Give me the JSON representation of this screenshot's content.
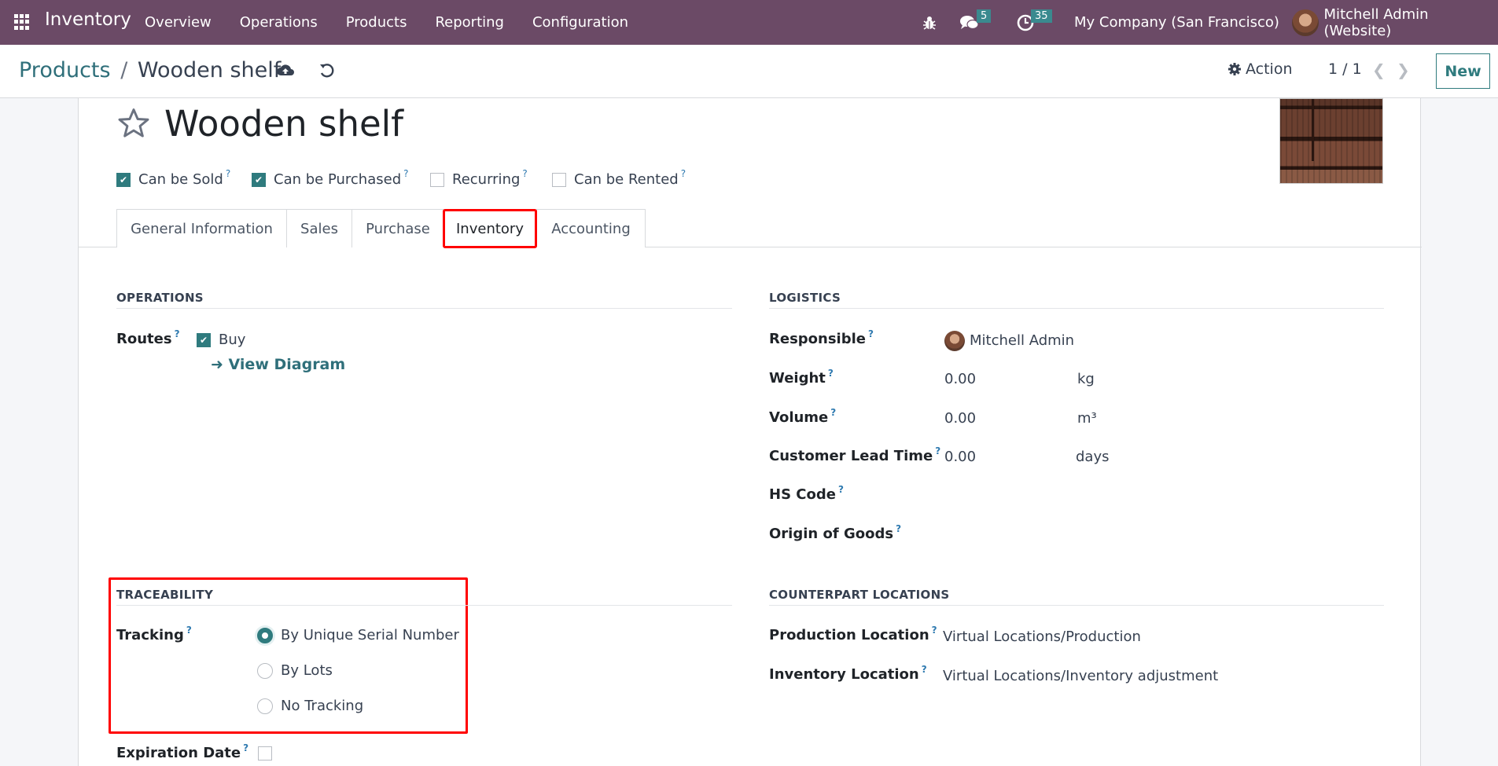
{
  "navbar": {
    "app_name": "Inventory",
    "menu": [
      "Overview",
      "Operations",
      "Products",
      "Reporting",
      "Configuration"
    ],
    "messages_count": "5",
    "activities_count": "35",
    "company": "My Company (San Francisco)",
    "user": "Mitchell Admin (Website)"
  },
  "control_panel": {
    "breadcrumb_parent": "Products",
    "breadcrumb_separator": "/",
    "breadcrumb_current": "Wooden shelf",
    "action_label": "Action",
    "pager": "1 / 1",
    "new_label": "New"
  },
  "product": {
    "name": "Wooden shelf",
    "flags": [
      {
        "label": "Can be Sold",
        "checked": true
      },
      {
        "label": "Can be Purchased",
        "checked": true
      },
      {
        "label": "Recurring",
        "checked": false
      },
      {
        "label": "Can be Rented",
        "checked": false
      }
    ]
  },
  "tabs": [
    {
      "label": "General Information",
      "active": false
    },
    {
      "label": "Sales",
      "active": false
    },
    {
      "label": "Purchase",
      "active": false
    },
    {
      "label": "Inventory",
      "active": true
    },
    {
      "label": "Accounting",
      "active": false
    }
  ],
  "help_mark": "?",
  "operations": {
    "title": "OPERATIONS",
    "routes_label": "Routes",
    "routes": [
      {
        "label": "Buy",
        "checked": true
      }
    ],
    "view_diagram": "View Diagram"
  },
  "logistics": {
    "title": "LOGISTICS",
    "responsible_label": "Responsible",
    "responsible": "Mitchell Admin",
    "weight_label": "Weight",
    "weight": "0.00",
    "weight_unit": "kg",
    "volume_label": "Volume",
    "volume": "0.00",
    "volume_unit": "m³",
    "lead_time_label": "Customer Lead Time",
    "lead_time": "0.00",
    "lead_time_unit": "days",
    "hs_code_label": "HS Code",
    "hs_code": "",
    "origin_label": "Origin of Goods",
    "origin": ""
  },
  "traceability": {
    "title": "TRACEABILITY",
    "tracking_label": "Tracking",
    "options": [
      {
        "label": "By Unique Serial Number",
        "selected": true
      },
      {
        "label": "By Lots",
        "selected": false
      },
      {
        "label": "No Tracking",
        "selected": false
      }
    ],
    "expiration_label": "Expiration Date",
    "expiration_checked": false
  },
  "counterpart": {
    "title": "COUNTERPART LOCATIONS",
    "production_label": "Production Location",
    "production": "Virtual Locations/Production",
    "inventory_label": "Inventory Location",
    "inventory": "Virtual Locations/Inventory adjustment"
  },
  "colors": {
    "navbar_bg": "#6b4a66",
    "accent": "#2f7b7e",
    "highlight": "#ff0000"
  }
}
